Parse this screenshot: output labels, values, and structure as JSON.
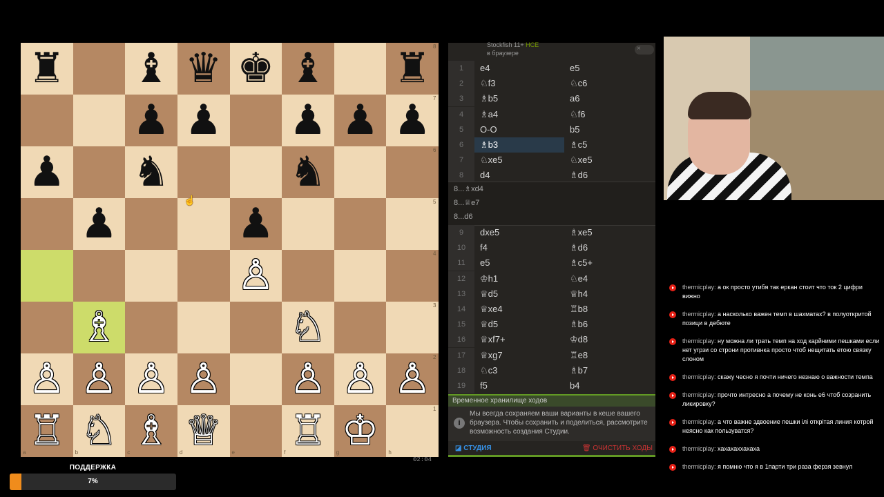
{
  "board": {
    "pieces": [
      [
        "♜",
        "",
        "♝",
        "♛",
        "♚",
        "♝",
        "",
        "♜"
      ],
      [
        "",
        "",
        "♟",
        "♟",
        "",
        "♟",
        "♟",
        "♟"
      ],
      [
        "♟",
        "",
        "♞",
        "",
        "",
        "♞",
        "",
        ""
      ],
      [
        "",
        "♟",
        "",
        "",
        "♟",
        "",
        "",
        ""
      ],
      [
        "",
        "",
        "",
        "",
        "♙",
        "",
        "",
        ""
      ],
      [
        "",
        "♗",
        "",
        "",
        "",
        "♘",
        "",
        ""
      ],
      [
        "♙",
        "♙",
        "♙",
        "♙",
        "",
        "♙",
        "♙",
        "♙"
      ],
      [
        "♖",
        "♘",
        "♗",
        "♕",
        "",
        "♖",
        "♔",
        ""
      ]
    ],
    "highlight": [
      "a4",
      "b3"
    ],
    "files": [
      "a",
      "b",
      "c",
      "d",
      "e",
      "f",
      "g",
      "h"
    ],
    "ranks": [
      "8",
      "7",
      "6",
      "5",
      "4",
      "3",
      "2",
      "1"
    ],
    "clock": "02:04"
  },
  "engine": {
    "name": "Stockfish 11+",
    "nnue": "HCE",
    "sub": "в браузере",
    "toggle_icon": "×"
  },
  "moves": [
    {
      "n": "1",
      "w": "e4",
      "b": "e5"
    },
    {
      "n": "2",
      "w": "♘f3",
      "b": "♘c6"
    },
    {
      "n": "3",
      "w": "♗b5",
      "b": "a6"
    },
    {
      "n": "4",
      "w": "♗a4",
      "b": "♘f6"
    },
    {
      "n": "5",
      "w": "O-O",
      "b": "b5"
    },
    {
      "n": "6",
      "w": "♗b3",
      "b": "♗c5",
      "active": "w"
    },
    {
      "n": "7",
      "w": "♘xe5",
      "b": "♘xe5"
    },
    {
      "n": "8",
      "w": "d4",
      "b": "♗d6"
    }
  ],
  "variations": [
    "8...♗xd4",
    "8...♕e7",
    "8...d6"
  ],
  "moves2": [
    {
      "n": "9",
      "w": "dxe5",
      "b": "♗xe5"
    },
    {
      "n": "10",
      "w": "f4",
      "b": "♗d6"
    },
    {
      "n": "11",
      "w": "e5",
      "b": "♗c5+"
    },
    {
      "n": "12",
      "w": "♔h1",
      "b": "♘e4"
    },
    {
      "n": "13",
      "w": "♕d5",
      "b": "♕h4"
    },
    {
      "n": "14",
      "w": "♕xe4",
      "b": "♖b8"
    },
    {
      "n": "15",
      "w": "♕d5",
      "b": "♗b6"
    },
    {
      "n": "16",
      "w": "♕xf7+",
      "b": "♔d8"
    },
    {
      "n": "17",
      "w": "♕xg7",
      "b": "♖e8"
    },
    {
      "n": "18",
      "w": "♘c3",
      "b": "♗b7"
    },
    {
      "n": "19",
      "w": "f5",
      "b": "b4"
    }
  ],
  "storage": {
    "title": "Временное хранилище ходов",
    "info_icon": "i",
    "info": "Мы всегда сохраняем ваши варианты в кеше вашего браузера. Чтобы сохранить и поделиться, рассмотрите возможность создания Студии.",
    "studio_icon": "◪",
    "studio": "СТУДИЯ",
    "clear_icon": "🗑",
    "clear": "ОЧИСТИТЬ ХОДЫ"
  },
  "chat": [
    {
      "user": "thermicplay:",
      "text": "а ок просто утибя так еркан стоит что ток 2 цифри вижно"
    },
    {
      "user": "thermicplay:",
      "text": "а насколько важен темп в шахматах? в полуоткритой позици в дебюте"
    },
    {
      "user": "thermicplay:",
      "text": "ну можна ли трать темп на ход карйними пешками если нет угрзи со строни противнка просто чтоб нещитать етою связку слоном"
    },
    {
      "user": "thermicplay:",
      "text": "скажу чесно я почти ничего незнаю о важности темпа"
    },
    {
      "user": "thermicplay:",
      "text": "прочто интресно а почему не конь е6 чтоб созранить ликировку?"
    },
    {
      "user": "thermicplay:",
      "text": "а что важне здвоение пешки ілі открітая линия котрой неясно как пользуватся?"
    },
    {
      "user": "thermicplay:",
      "text": "хахахаххахаха"
    },
    {
      "user": "thermicplay:",
      "text": "я помню что я в 1парти три раза ферзя зевнул"
    }
  ],
  "support": {
    "label": "ПОДДЕРЖКА",
    "percent_text": "7%",
    "fraction": 0.07,
    "color": "#f08c1c"
  }
}
